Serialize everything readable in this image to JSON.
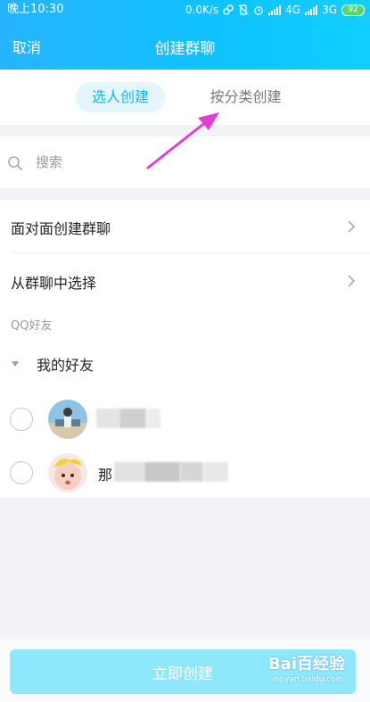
{
  "status_bar": {
    "time": "晚上10:30",
    "net_speed": "0.0K/s",
    "network_4g": "4G",
    "network_3g": "3G",
    "battery": "92"
  },
  "header": {
    "cancel_label": "取消",
    "title": "创建群聊"
  },
  "tabs": [
    {
      "label": "选人创建",
      "active": true
    },
    {
      "label": "按分类创建",
      "active": false
    }
  ],
  "search": {
    "placeholder": "搜索",
    "value": ""
  },
  "nav_items": [
    {
      "label": "面对面创建群聊"
    },
    {
      "label": "从群聊中选择"
    }
  ],
  "section_label": "QQ好友",
  "group": {
    "label": "我的好友"
  },
  "friends": [
    {
      "name": ""
    },
    {
      "name": "那"
    }
  ],
  "footer": {
    "create_label": "立即创建"
  },
  "watermark": {
    "logo": "Bai百经验",
    "url": "jingyan.baidu.com"
  },
  "colors": {
    "header_gradient_start": "#27b4ff",
    "header_gradient_end": "#10cfff",
    "tab_active_bg": "#e3f6fd",
    "tab_active_text": "#19b5ea",
    "button_bg": "#8ee8fb",
    "annotation_arrow": "#e43dd4"
  }
}
